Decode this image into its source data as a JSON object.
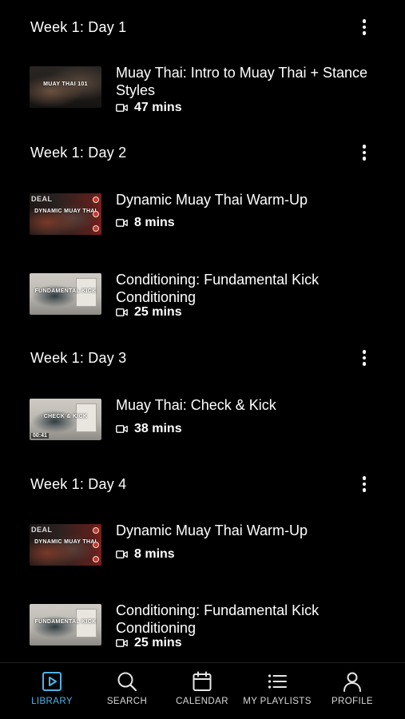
{
  "days": [
    {
      "title": "Week 1: Day 1",
      "videos": [
        {
          "title": "Muay Thai: Intro to Muay Thai + Stance Styles",
          "duration": "47 mins",
          "thumb_caption": "MUAY THAI 101"
        }
      ]
    },
    {
      "title": "Week 1: Day 2",
      "videos": [
        {
          "title": "Dynamic Muay Thai Warm-Up",
          "duration": "8 mins",
          "thumb_caption": "DYNAMIC MUAY THAI",
          "thumb_brand": "DEAL"
        },
        {
          "title": "Conditioning: Fundamental Kick Conditioning",
          "duration": "25 mins",
          "thumb_caption": "FUNDAMENTAL KICK"
        }
      ]
    },
    {
      "title": "Week 1: Day 3",
      "videos": [
        {
          "title": "Muay Thai: Check & Kick",
          "duration": "38 mins",
          "thumb_caption": "CHECK & KICK",
          "thumb_time": "00:41"
        }
      ]
    },
    {
      "title": "Week 1: Day 4",
      "videos": [
        {
          "title": "Dynamic Muay Thai Warm-Up",
          "duration": "8 mins",
          "thumb_caption": "DYNAMIC MUAY THAI",
          "thumb_brand": "DEAL"
        },
        {
          "title": "Conditioning: Fundamental Kick Conditioning",
          "duration": "25 mins",
          "thumb_caption": "FUNDAMENTAL KICK"
        }
      ]
    }
  ],
  "tabs": [
    {
      "label": "LIBRARY",
      "icon": "play-square-icon",
      "active": true
    },
    {
      "label": "SEARCH",
      "icon": "search-icon",
      "active": false
    },
    {
      "label": "CALENDAR",
      "icon": "calendar-icon",
      "active": false
    },
    {
      "label": "MY PLAYLISTS",
      "icon": "list-icon",
      "active": false
    },
    {
      "label": "PROFILE",
      "icon": "person-icon",
      "active": false
    }
  ],
  "colors": {
    "background": "#000000",
    "text": "#ffffff",
    "accent": "#4fb3e6",
    "tab_inactive": "#d9d9d9"
  }
}
